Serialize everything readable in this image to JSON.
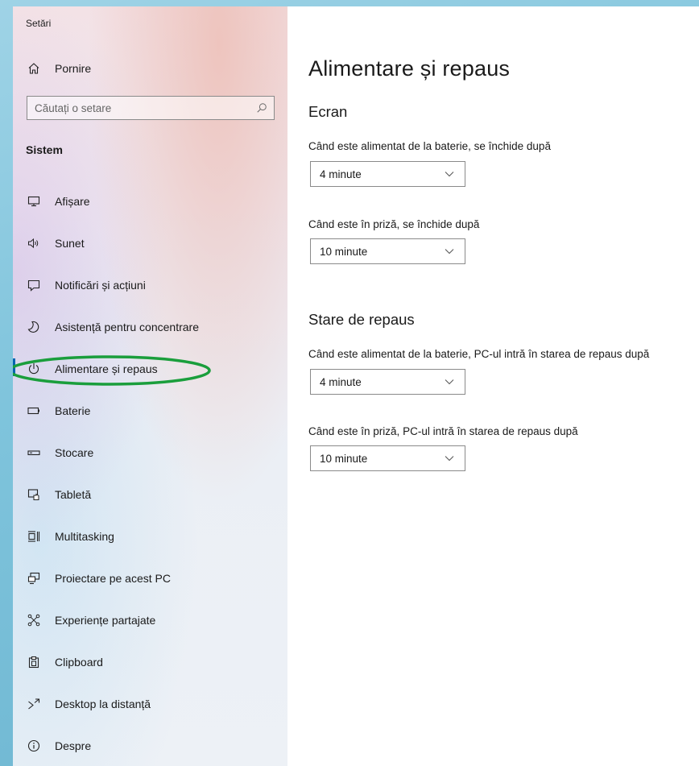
{
  "window": {
    "title": "Setări"
  },
  "sidebar": {
    "home_label": "Pornire",
    "search_placeholder": "Căutați o setare",
    "section_title": "Sistem",
    "items": [
      {
        "label": "Afișare",
        "icon": "display-icon"
      },
      {
        "label": "Sunet",
        "icon": "speaker-icon"
      },
      {
        "label": "Notificări și acțiuni",
        "icon": "notification-icon"
      },
      {
        "label": "Asistență pentru concentrare",
        "icon": "moon-icon"
      },
      {
        "label": "Alimentare și repaus",
        "icon": "power-icon",
        "selected": true
      },
      {
        "label": "Baterie",
        "icon": "battery-icon"
      },
      {
        "label": "Stocare",
        "icon": "storage-icon"
      },
      {
        "label": "Tabletă",
        "icon": "tablet-icon"
      },
      {
        "label": "Multitasking",
        "icon": "multitasking-icon"
      },
      {
        "label": "Proiectare pe acest PC",
        "icon": "projection-icon"
      },
      {
        "label": "Experiențe partajate",
        "icon": "shared-experiences-icon"
      },
      {
        "label": "Clipboard",
        "icon": "clipboard-icon"
      },
      {
        "label": "Desktop la distanță",
        "icon": "remote-desktop-icon"
      },
      {
        "label": "Despre",
        "icon": "info-icon"
      }
    ]
  },
  "main": {
    "title": "Alimentare și repaus",
    "screen": {
      "heading": "Ecran",
      "battery_label": "Când este alimentat de la baterie, se închide după",
      "battery_value": "4 minute",
      "plugged_label": "Când este în priză, se închide după",
      "plugged_value": "10 minute"
    },
    "sleep": {
      "heading": "Stare de repaus",
      "battery_label": "Când este alimentat de la baterie, PC-ul intră în starea de repaus după",
      "battery_value": "4 minute",
      "plugged_label": "Când este în priză, PC-ul intră în starea de repaus după",
      "plugged_value": "10 minute"
    }
  },
  "colors": {
    "accent": "#0063b1",
    "annotation_ellipse": "#1a9e3c"
  }
}
